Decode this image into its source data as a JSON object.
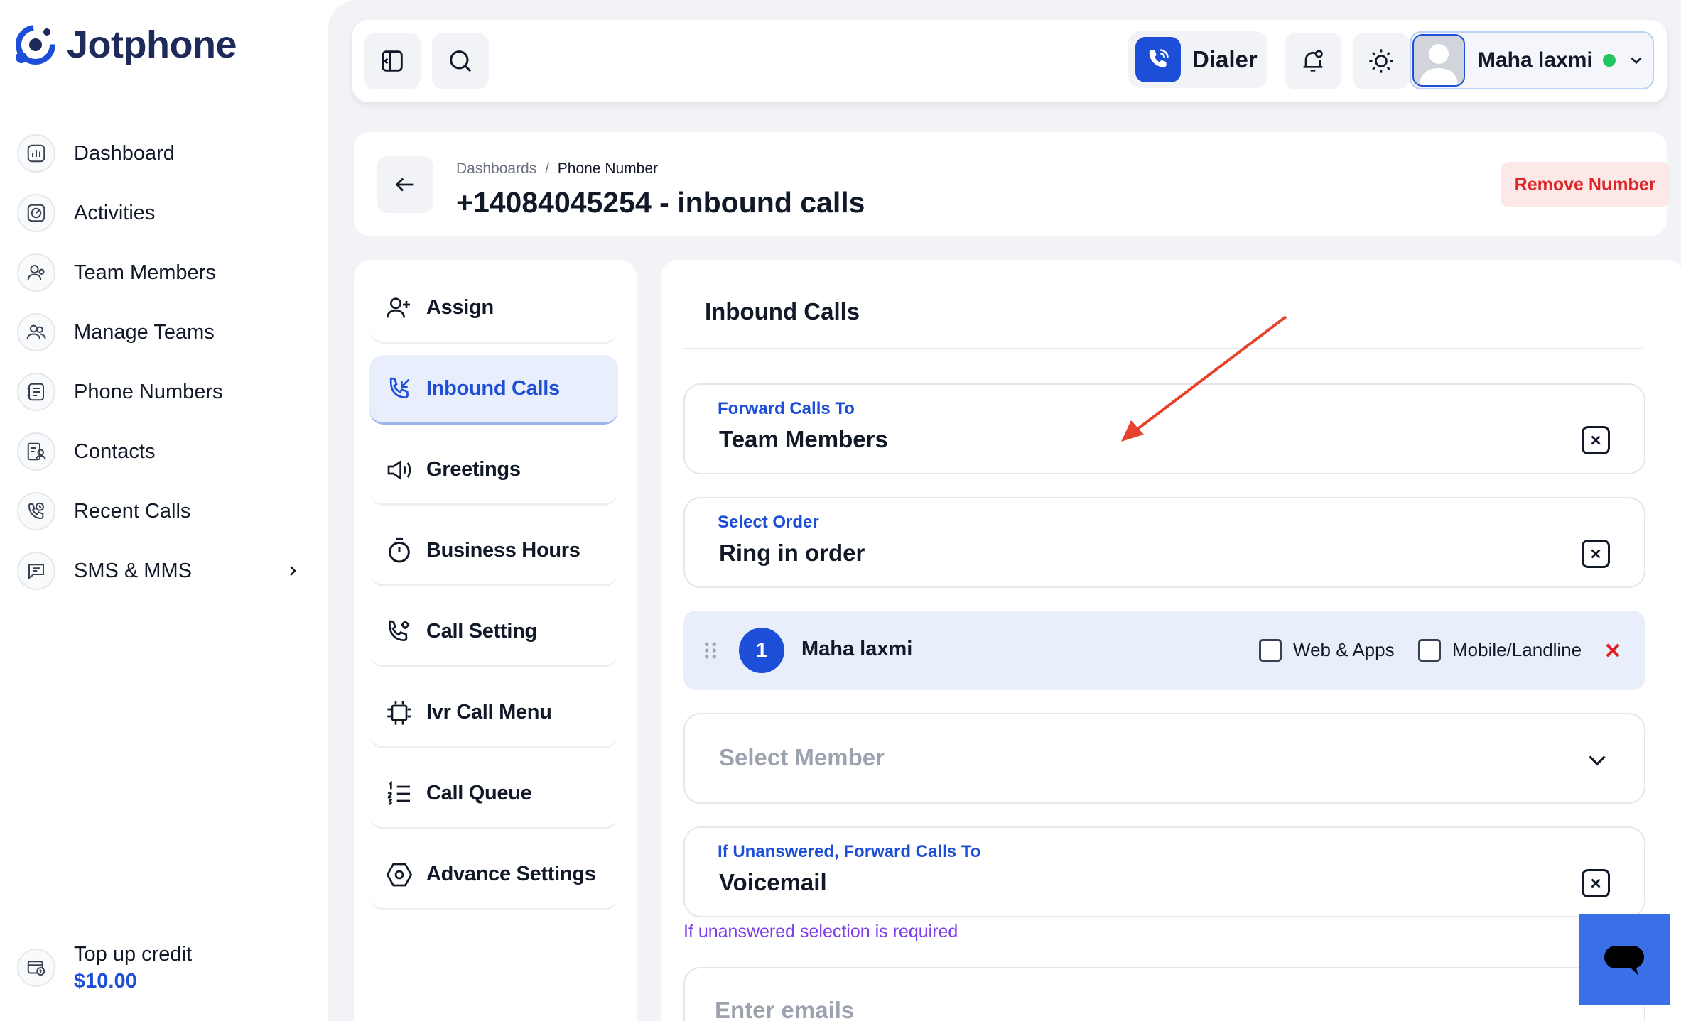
{
  "app": {
    "name": "Jotphone"
  },
  "sidebar": {
    "items": [
      {
        "label": "Dashboard",
        "icon": "chart-icon"
      },
      {
        "label": "Activities",
        "icon": "activity-icon"
      },
      {
        "label": "Team Members",
        "icon": "team-members-icon"
      },
      {
        "label": "Manage Teams",
        "icon": "manage-teams-icon"
      },
      {
        "label": "Phone Numbers",
        "icon": "phone-book-icon"
      },
      {
        "label": "Contacts",
        "icon": "contacts-icon"
      },
      {
        "label": "Recent Calls",
        "icon": "recent-calls-icon"
      },
      {
        "label": "SMS & MMS",
        "icon": "message-icon"
      }
    ],
    "credit": {
      "label": "Top up credit",
      "value": "$10.00"
    }
  },
  "topbar": {
    "dialer_label": "Dialer",
    "user": {
      "name": "Maha laxmi",
      "status_color": "#22c55e"
    }
  },
  "header": {
    "breadcrumb": {
      "parent": "Dashboards",
      "separator": "/",
      "current": "Phone Number"
    },
    "title": "+14084045254 - inbound calls",
    "remove_label": "Remove Number"
  },
  "menu": {
    "items": [
      {
        "label": "Assign",
        "icon": "user-plus-icon",
        "active": false
      },
      {
        "label": "Inbound Calls",
        "icon": "inbound-call-icon",
        "active": true
      },
      {
        "label": "Greetings",
        "icon": "speaker-icon",
        "active": false
      },
      {
        "label": "Business Hours",
        "icon": "timer-icon",
        "active": false
      },
      {
        "label": "Call Setting",
        "icon": "phone-gear-icon",
        "active": false
      },
      {
        "label": "Ivr Call Menu",
        "icon": "ivr-frame-icon",
        "active": false
      },
      {
        "label": "Call Queue",
        "icon": "numbered-list-icon",
        "active": false
      },
      {
        "label": "Advance Settings",
        "icon": "hexagon-gear-icon",
        "active": false
      }
    ]
  },
  "inbound": {
    "title": "Inbound Calls",
    "forward": {
      "label": "Forward Calls To",
      "value": "Team Members"
    },
    "order": {
      "label": "Select Order",
      "value": "Ring in order"
    },
    "member": {
      "number": "1",
      "name": "Maha laxmi",
      "web_apps_label": "Web & Apps",
      "mobile_label": "Mobile/Landline"
    },
    "select_member_placeholder": "Select Member",
    "unanswered": {
      "label": "If Unanswered, Forward Calls To",
      "value": "Voicemail"
    },
    "error": "If unanswered selection is required",
    "emails_placeholder": "Enter emails"
  },
  "colors": {
    "accent": "#1d4ed8",
    "danger": "#dc2626",
    "annotation_arrow": "#e5432f",
    "chat_widget": "#3b6fe8"
  }
}
